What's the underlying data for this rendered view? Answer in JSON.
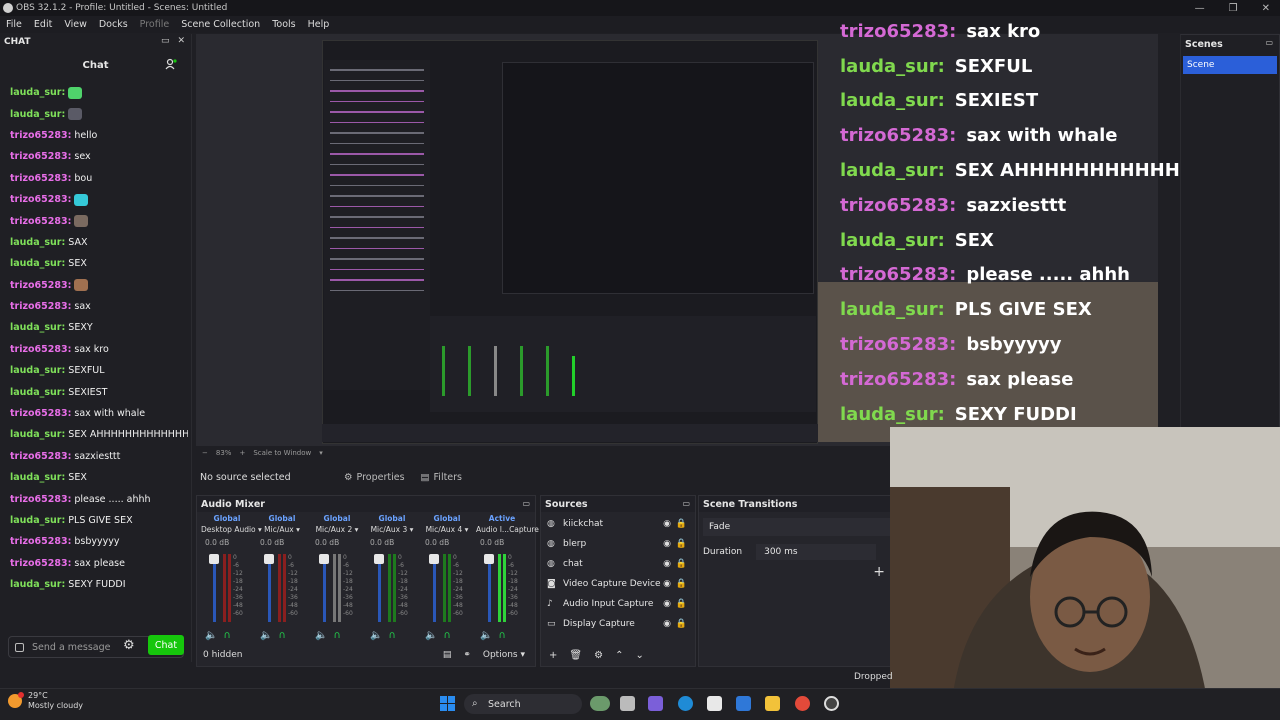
{
  "window": {
    "title": "OBS 32.1.2 - Profile: Untitled - Scenes: Untitled",
    "controls": [
      "—",
      "❐",
      "✕"
    ]
  },
  "menu": [
    "File",
    "Edit",
    "View",
    "Docks",
    "Profile",
    "Scene Collection",
    "Tools",
    "Help"
  ],
  "chat_dock": {
    "dock_title": "CHAT",
    "header": "Chat",
    "messages": [
      {
        "user": "lauda_sur:",
        "color": "u2",
        "text": "",
        "emote": "#4fd36b"
      },
      {
        "user": "lauda_sur:",
        "color": "u2",
        "text": "",
        "emote": "#5a5a66"
      },
      {
        "user": "trizo65283:",
        "color": "u1",
        "text": "hello"
      },
      {
        "user": "trizo65283:",
        "color": "u1",
        "text": "sex"
      },
      {
        "user": "trizo65283:",
        "color": "u1",
        "text": "bou"
      },
      {
        "user": "trizo65283:",
        "color": "u1",
        "text": "",
        "emote": "#35c9d8"
      },
      {
        "user": "trizo65283:",
        "color": "u1",
        "text": "",
        "emote": "#7a6a60"
      },
      {
        "user": "lauda_sur:",
        "color": "u2",
        "text": "SAX"
      },
      {
        "user": "lauda_sur:",
        "color": "u2",
        "text": "SEX"
      },
      {
        "user": "trizo65283:",
        "color": "u1",
        "text": "",
        "emote": "#a07050"
      },
      {
        "user": "trizo65283:",
        "color": "u1",
        "text": "sax"
      },
      {
        "user": "lauda_sur:",
        "color": "u2",
        "text": "SEXY"
      },
      {
        "user": "trizo65283:",
        "color": "u1",
        "text": "sax kro"
      },
      {
        "user": "lauda_sur:",
        "color": "u2",
        "text": "SEXFUL"
      },
      {
        "user": "lauda_sur:",
        "color": "u2",
        "text": "SEXIEST"
      },
      {
        "user": "trizo65283:",
        "color": "u1",
        "text": "sax with whale"
      },
      {
        "user": "lauda_sur:",
        "color": "u2",
        "text": "SEX AHHHHHHHHHHHHH"
      },
      {
        "user": "trizo65283:",
        "color": "u1",
        "text": "sazxiesttt"
      },
      {
        "user": "lauda_sur:",
        "color": "u2",
        "text": "SEX"
      },
      {
        "user": "trizo65283:",
        "color": "u1",
        "text": "please ..... ahhh"
      },
      {
        "user": "lauda_sur:",
        "color": "u2",
        "text": "PLS GIVE SEX"
      },
      {
        "user": "trizo65283:",
        "color": "u1",
        "text": "bsbyyyyy"
      },
      {
        "user": "trizo65283:",
        "color": "u1",
        "text": "sax please"
      },
      {
        "user": "lauda_sur:",
        "color": "u2",
        "text": "SEXY FUDDI"
      }
    ],
    "input_placeholder": "Send a message",
    "chat_button": "Chat"
  },
  "overlay": [
    {
      "user": "trizo65283:",
      "color": "u1",
      "text": "sax kro"
    },
    {
      "user": "lauda_sur:",
      "color": "u2",
      "text": "SEXFUL"
    },
    {
      "user": "lauda_sur:",
      "color": "u2",
      "text": "SEXIEST"
    },
    {
      "user": "trizo65283:",
      "color": "u1",
      "text": "sax with whale"
    },
    {
      "user": "lauda_sur:",
      "color": "u2",
      "text": "SEX AHHHHHHHHHHHHH"
    },
    {
      "user": "trizo65283:",
      "color": "u1",
      "text": "sazxiesttt"
    },
    {
      "user": "lauda_sur:",
      "color": "u2",
      "text": "SEX"
    },
    {
      "user": "trizo65283:",
      "color": "u1",
      "text": "please ..... ahhh"
    },
    {
      "user": "lauda_sur:",
      "color": "u2",
      "text": "PLS GIVE SEX"
    },
    {
      "user": "trizo65283:",
      "color": "u1",
      "text": "bsbyyyyy"
    },
    {
      "user": "trizo65283:",
      "color": "u1",
      "text": "sax please"
    },
    {
      "user": "lauda_sur:",
      "color": "u2",
      "text": "SEXY FUDDI"
    }
  ],
  "scenes": {
    "title": "Scenes",
    "items": [
      "Scene"
    ]
  },
  "preview_toolbar": {
    "zoom": "83%",
    "scale": "Scale to Window"
  },
  "source_row": {
    "no_source": "No source selected",
    "properties": "Properties",
    "filters": "Filters"
  },
  "audio_mixer": {
    "title": "Audio Mixer",
    "channels": [
      {
        "global": "Global",
        "name": "Desktop Audio",
        "db": "0.0 dB"
      },
      {
        "global": "Global",
        "name": "Mic/Aux",
        "db": "0.0 dB"
      },
      {
        "global": "Global",
        "name": "Mic/Aux 2",
        "db": "0.0 dB"
      },
      {
        "global": "Global",
        "name": "Mic/Aux 3",
        "db": "0.0 dB"
      },
      {
        "global": "Global",
        "name": "Mic/Aux 4",
        "db": "0.0 dB"
      },
      {
        "global": "Active",
        "name": "Audio I...Capture",
        "db": "0.0 dB"
      }
    ],
    "hidden": "0 hidden",
    "options": "Options"
  },
  "sources": {
    "title": "Sources",
    "items": [
      {
        "name": "kiickchat",
        "icon": "globe-icon"
      },
      {
        "name": "blerp",
        "icon": "globe-icon"
      },
      {
        "name": "chat",
        "icon": "globe-icon"
      },
      {
        "name": "Video Capture Device",
        "icon": "camera-icon"
      },
      {
        "name": "Audio Input Capture",
        "icon": "mic-icon"
      },
      {
        "name": "Display Capture",
        "icon": "monitor-icon"
      }
    ]
  },
  "transitions": {
    "title": "Scene Transitions",
    "type": "Fade",
    "duration_label": "Duration",
    "duration_value": "300 ms"
  },
  "status": {
    "dropped": "Dropped"
  },
  "taskbar": {
    "temp": "29°C",
    "weather": "Mostly cloudy",
    "search": "Search"
  }
}
